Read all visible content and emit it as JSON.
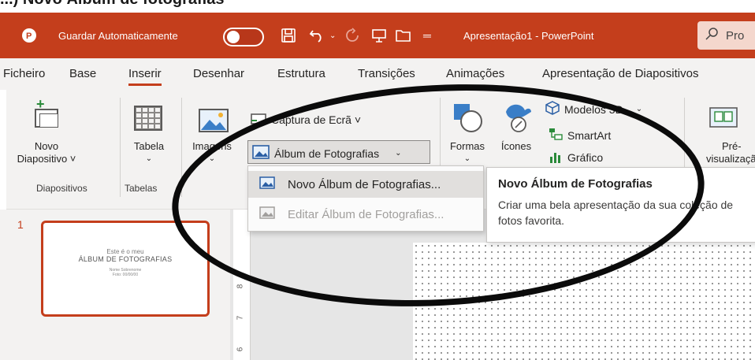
{
  "caption": "...) Novo Álbum de fotografias",
  "titlebar": {
    "autosave_label": "Guardar Automaticamente",
    "window_title": "Apresentação1  -  PowerPoint",
    "search_text": "Pro"
  },
  "tabs": [
    "Ficheiro",
    "Base",
    "Inserir",
    "Desenhar",
    "Estrutura",
    "Transições",
    "Animações",
    "Apresentação de Diapositivos"
  ],
  "active_tab": "Inserir",
  "ribbon": {
    "novo_diapositivo_1": "Novo",
    "novo_diapositivo_2": "Diapositivo ˅",
    "tabela": "Tabela",
    "imagens": "Imagens",
    "captura": "Captura de Ecrã ˅",
    "album": "Álbum de Fotografias",
    "formas": "Formas",
    "icones": "Ícones",
    "modelos3d": "Modelos 3D",
    "smartart": "SmartArt",
    "grafico": "Gráfico",
    "pre_1": "Pré-",
    "pre_2": "visualização",
    "group_diapositivos": "Diapositivos",
    "group_tabelas": "Tabelas"
  },
  "dropdown": {
    "new_album": "Novo Álbum de Fotografias...",
    "edit_album": "Editar Álbum de Fotografias..."
  },
  "tooltip": {
    "title": "Novo Álbum de Fotografias",
    "body": "Criar uma bela apresentação da sua coleção de fotos favorita."
  },
  "thumbnail": {
    "number": "1",
    "line1": "Este é o meu",
    "line2": "ÁLBUM DE FOTOGRAFIAS",
    "line3": "Nome Sobrenome",
    "line4": "Foto: 00/00/00"
  },
  "ruler": [
    "8",
    "7",
    "6"
  ],
  "colors": {
    "accent": "#c43e1c",
    "ribbon_bg": "#f3f2f1"
  }
}
